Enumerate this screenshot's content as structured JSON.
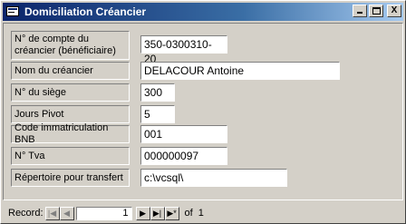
{
  "window": {
    "title": "Domiciliation Créancier",
    "min_label": "_",
    "close_label": "X"
  },
  "fields": [
    {
      "label": "N° de compte du créancier (bénéficiaire)",
      "value": "350-0300310-20"
    },
    {
      "label": "Nom du créancier",
      "value": "DELACOUR Antoine"
    },
    {
      "label": "N° du siège",
      "value": "300"
    },
    {
      "label": "Jours Pivot",
      "value": "5"
    },
    {
      "label": "Code immatriculation BNB",
      "value": "001"
    },
    {
      "label": "N° Tva",
      "value": "000000097"
    },
    {
      "label": "Répertoire pour transfert",
      "value": "c:\\vcsql\\"
    }
  ],
  "navigation": {
    "record_label": "Record:",
    "current_record": "1",
    "of_label": "of",
    "total_records": "1",
    "first_glyph": "|◀",
    "prev_glyph": "◀",
    "next_glyph": "▶",
    "last_glyph": "▶|",
    "new_glyph": "▶*"
  },
  "icons": {
    "form": "form-icon",
    "minimize": "minimize-icon",
    "maximize": "maximize-icon",
    "close": "close-icon"
  }
}
